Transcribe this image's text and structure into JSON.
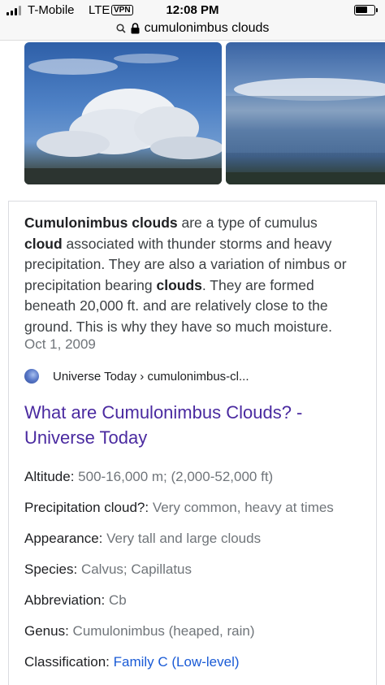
{
  "status_bar": {
    "carrier": "T-Mobile",
    "network": "LTE",
    "vpn": "VPN",
    "time": "12:08 PM"
  },
  "url_bar": {
    "query": "cumulonimbus clouds"
  },
  "snippet": {
    "t1": "Cumulonimbus clouds",
    "t2": " are a type of cumulus ",
    "t3": "cloud",
    "t4": " associated with thunder storms and heavy precipitation. They are also a variation of nimbus or precipitation bearing ",
    "t5": "clouds",
    "t6": ". They are formed beneath 20,000 ft. and are relatively close to the ground. This is why they have so much moisture.",
    "date": "Oct 1, 2009"
  },
  "source": {
    "site": "Universe Today",
    "path": " › cumulonimbus-cl..."
  },
  "result": {
    "title": "What are Cumulonimbus Clouds? - Universe Today"
  },
  "facts": [
    {
      "key": "Altitude: ",
      "value": "500-16,000 m; (2,000-52,000 ft)"
    },
    {
      "key": "Precipitation cloud?: ",
      "value": "Very common, heavy at times"
    },
    {
      "key": "Appearance: ",
      "value": "Very tall and large clouds"
    },
    {
      "key": "Species: ",
      "value": "Calvus; Capillatus"
    },
    {
      "key": "Abbreviation: ",
      "value": "Cb"
    },
    {
      "key": "Genus: ",
      "value": "Cumulonimbus (heaped, rain)"
    },
    {
      "key": "Classification: ",
      "value": "Family C (Low-level)"
    }
  ],
  "colors": {
    "link_visited": "#4a2aa0",
    "link": "#1a5bd6"
  },
  "icons": [
    "signal-icon",
    "battery-icon",
    "search-icon",
    "lock-icon",
    "universe-today-favicon"
  ]
}
